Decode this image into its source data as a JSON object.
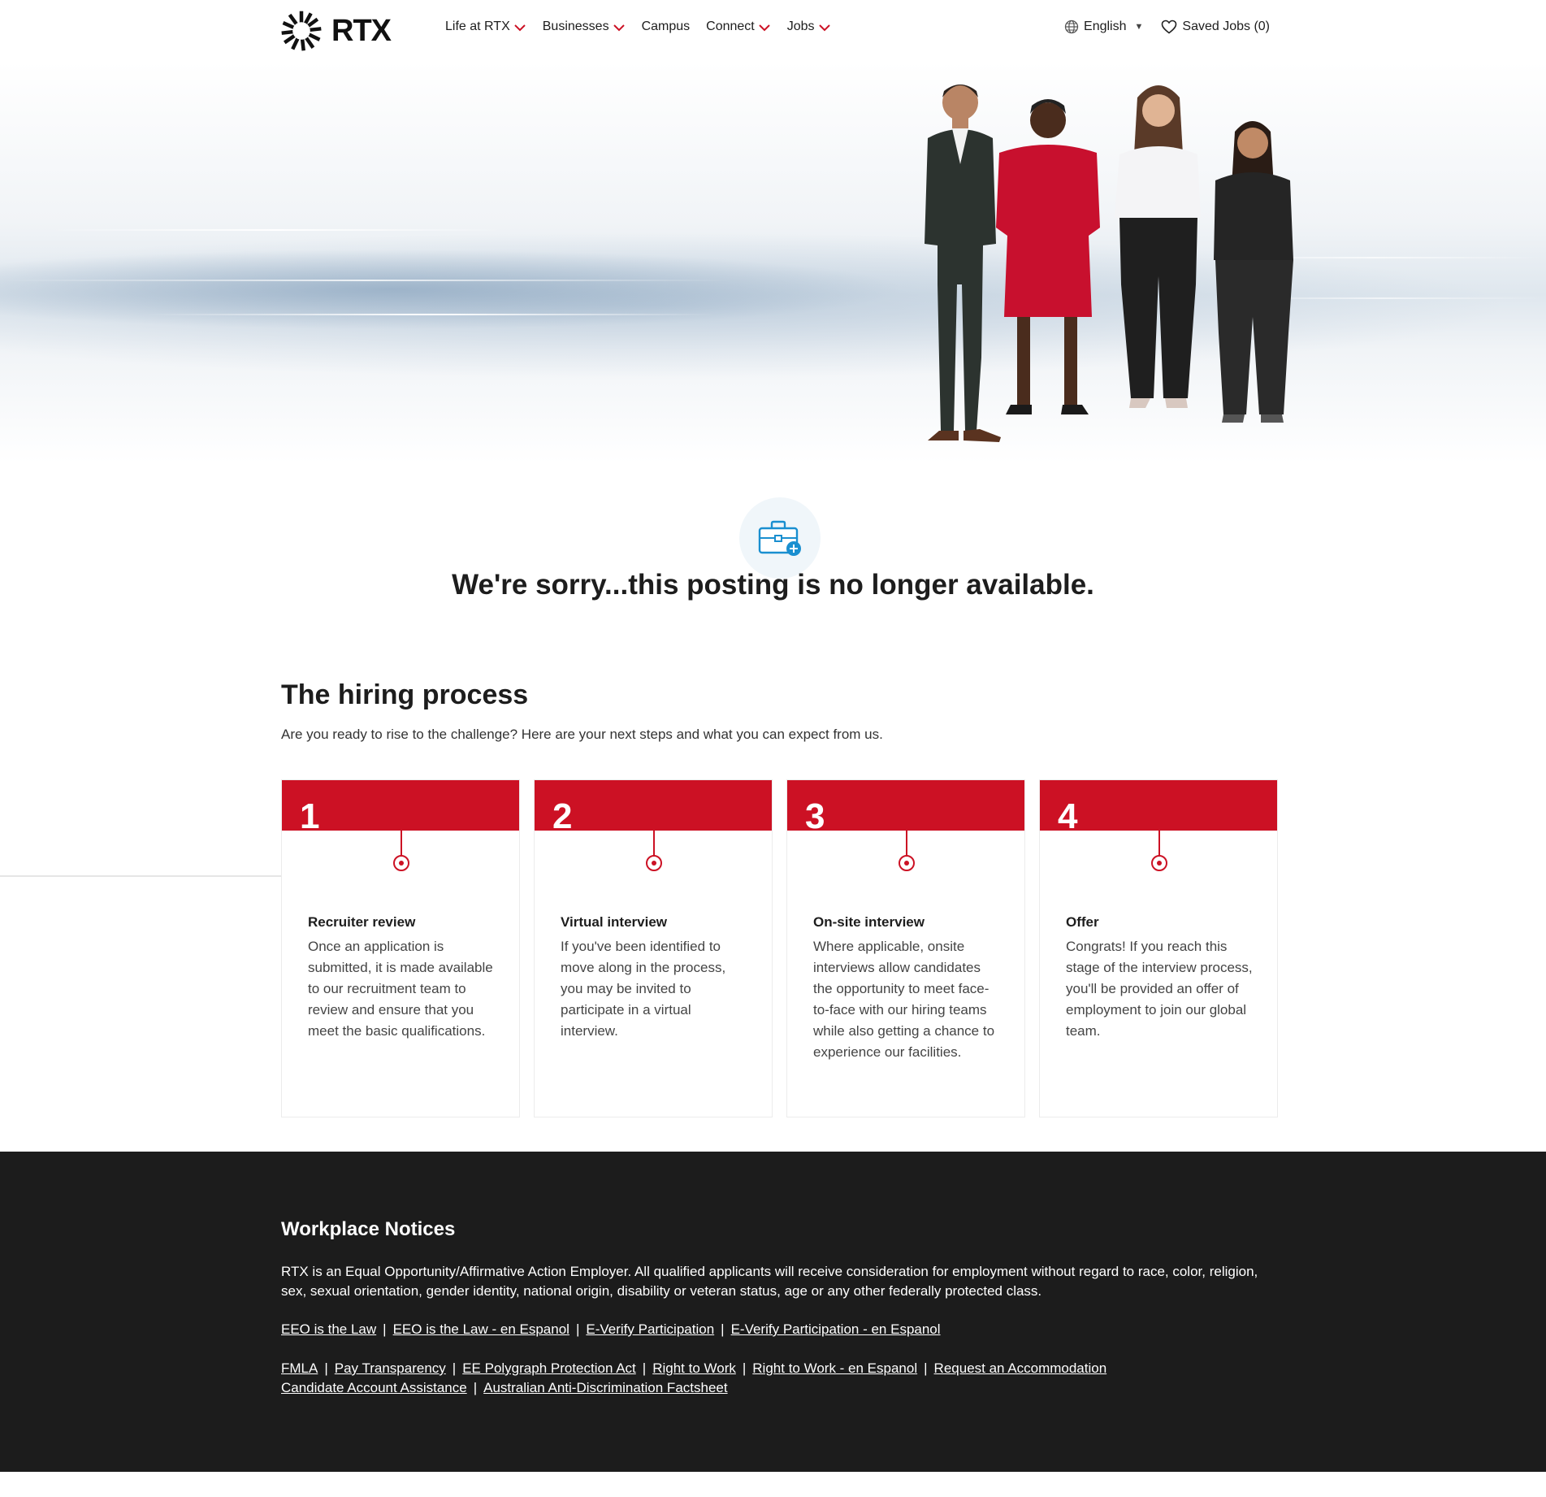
{
  "header": {
    "logo_text": "RTX",
    "nav": [
      {
        "label": "Life at RTX",
        "has_dropdown": true
      },
      {
        "label": "Businesses",
        "has_dropdown": true
      },
      {
        "label": "Campus",
        "has_dropdown": false
      },
      {
        "label": "Connect",
        "has_dropdown": true
      },
      {
        "label": "Jobs",
        "has_dropdown": true
      }
    ],
    "language": "English",
    "saved_jobs": "Saved Jobs (0)"
  },
  "notice": {
    "icon": "briefcase-plus-icon",
    "title": "We're sorry...this posting is no longer available."
  },
  "hiring": {
    "title": "The hiring process",
    "subtitle": "Are you ready to rise to the challenge? Here are your next steps and what you can expect from us.",
    "steps": [
      {
        "num": "1",
        "title": "Recruiter review",
        "body": "Once an application is submitted, it is made available to our recruitment team to review and ensure that you meet the basic qualifications."
      },
      {
        "num": "2",
        "title": "Virtual interview",
        "body": "If you've been identified to move along in the process, you may be invited to participate in a virtual interview."
      },
      {
        "num": "3",
        "title": "On-site interview",
        "body": "Where applicable, onsite interviews allow candidates the opportunity to meet face-to-face with our hiring teams while also getting a chance to experience our facilities."
      },
      {
        "num": "4",
        "title": "Offer",
        "body": "Congrats! If you reach this stage of the interview process, you'll be provided an offer of employment to join our global team."
      }
    ]
  },
  "footer": {
    "title": "Workplace Notices",
    "text": "RTX is an Equal Opportunity/Affirmative Action Employer. All qualified applicants will receive consideration for employment without regard to race, color, religion, sex, sexual orientation, gender identity, national origin, disability or veteran status, age or any other federally protected class.",
    "links_row1": [
      "EEO is the Law",
      "EEO is the Law - en Espanol",
      "E-Verify Participation",
      "E-Verify Participation - en Espanol"
    ],
    "links_row2": [
      "FMLA",
      "Pay Transparency",
      "EE Polygraph Protection Act",
      "Right to Work",
      "Right to Work - en Espanol",
      "Request an Accommodation"
    ],
    "links_row3": [
      "Candidate Account Assistance",
      "Australian Anti-Discrimination Factsheet"
    ],
    "separator": "|"
  },
  "colors": {
    "brand_red": "#cc1124",
    "footer_bg": "#1c1c1c",
    "icon_blue": "#1a8fd0"
  }
}
